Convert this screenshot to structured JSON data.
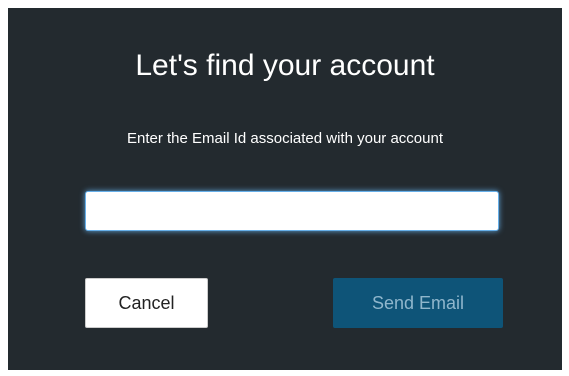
{
  "dialog": {
    "title": "Let's find your account",
    "instruction": "Enter the Email Id associated with your account",
    "email_input": {
      "value": "",
      "placeholder": ""
    },
    "cancel_label": "Cancel",
    "send_label": "Send Email",
    "colors": {
      "background": "#232a2f",
      "send_button": "#0e5478",
      "send_button_text": "#8fb6cc",
      "input_focus_glow": "#66afe9"
    }
  }
}
